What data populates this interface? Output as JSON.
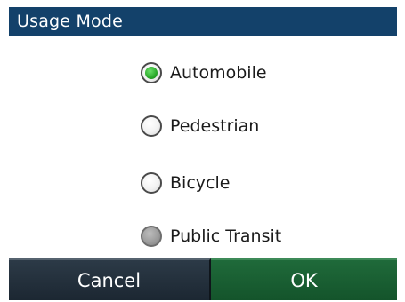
{
  "dialog": {
    "title": "Usage Mode"
  },
  "options": [
    {
      "label": "Automobile",
      "state": "selected"
    },
    {
      "label": "Pedestrian",
      "state": "unselected"
    },
    {
      "label": "Bicycle",
      "state": "unselected"
    },
    {
      "label": "Public Transit",
      "state": "disabled"
    }
  ],
  "buttons": {
    "cancel_label": "Cancel",
    "ok_label": "OK"
  },
  "colors": {
    "title_bar": "#13416a",
    "cancel_button": "#1c2732",
    "ok_button": "#14542b",
    "selected_radio": "#2aa92a"
  }
}
